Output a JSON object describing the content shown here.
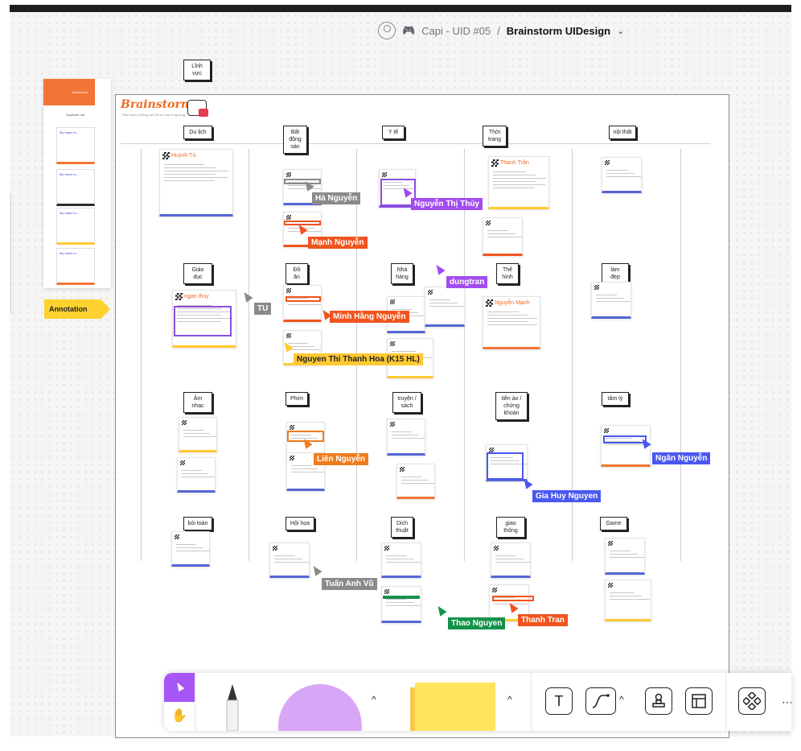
{
  "header": {
    "project": "Capi - UID #05",
    "separator": "/",
    "board": "Brainstorm UIDesign",
    "chevron": "⌄",
    "game_icon": "gamepad-icon"
  },
  "outside": {
    "linh_vuc": "Lĩnh vực",
    "annotation": "Annotation",
    "left_frame_title": "Brainstorm",
    "left_frame_label": "Duplicate me",
    "mini_label": "My name is..."
  },
  "board": {
    "brand": "Brainstorm",
    "subtitle": "Thảo luận ý tưởng chủ đề cho các ứng dụng",
    "topics": [
      "Du lịch",
      "Bất động sản",
      "Y tế",
      "Thời trang",
      "nội thất",
      "Giáo dục",
      "Đồ ăn",
      "Nhà hàng",
      "Thể hình",
      "làm đẹp",
      "Âm nhạc",
      "Phim",
      "truyện / sách",
      "tiền ảo / chứng khoán",
      "tâm lý",
      "bói toán",
      "Hội họa",
      "Dịch thuật",
      "giao thông",
      "Game"
    ],
    "note_big": "Huỳnh Tú",
    "note_ngan": "ngan thuy",
    "note_thanh": "Thanh Trần",
    "note_nguyen": "Nguyễn Mạnh"
  },
  "cursors": [
    {
      "name": "Hà Nguyễn",
      "color": "#8a8a8a"
    },
    {
      "name": "Mạnh Nguyễn",
      "color": "#f0541e"
    },
    {
      "name": "Nguyễn Thị Thủy",
      "color": "#a24cf0"
    },
    {
      "name": "dungtran",
      "color": "#a24cf0"
    },
    {
      "name": "TU",
      "color": "#8a8a8a"
    },
    {
      "name": "Minh Hằng Nguyễn",
      "color": "#f0541e"
    },
    {
      "name": "Nguyen Thi Thanh Hoa (K15 HL)",
      "color": "#ffc933"
    },
    {
      "name": "Liên Nguyễn",
      "color": "#f07c1e"
    },
    {
      "name": "Ngân Nguyễn",
      "color": "#4a58f0"
    },
    {
      "name": "Gia Huy Nguyen",
      "color": "#4a58f0"
    },
    {
      "name": "Tuấn Anh Vũ",
      "color": "#8a8a8a"
    },
    {
      "name": "Thao Nguyen",
      "color": "#14924a"
    },
    {
      "name": "Thanh Tran",
      "color": "#f0541e"
    }
  ],
  "toolbar": {
    "select_icon": "cursor-icon",
    "hand_icon": "hand-icon",
    "text_tool": "T",
    "caret": "^",
    "more": "⋯"
  }
}
